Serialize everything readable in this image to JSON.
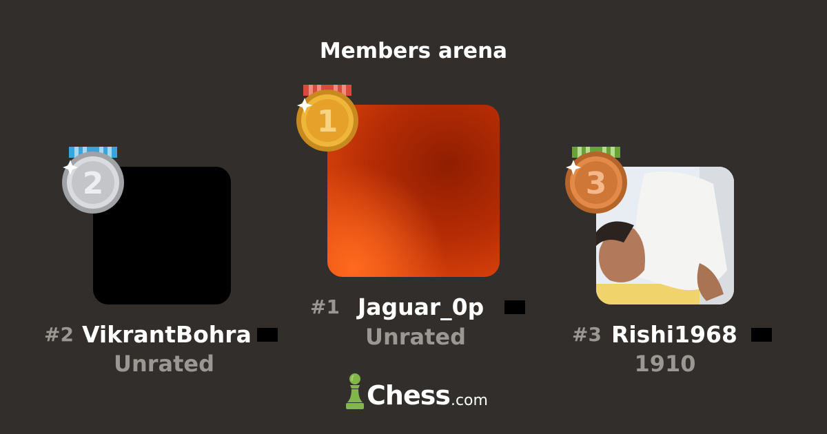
{
  "title": "Members arena",
  "players": [
    {
      "rank": "#1",
      "username": "Jaguar_0p",
      "rating": "Unrated",
      "medal": "gold-medal-1",
      "medal_digit": "1"
    },
    {
      "rank": "#2",
      "username": "VikrantBohra",
      "rating": "Unrated",
      "medal": "silver-medal-2",
      "medal_digit": "2"
    },
    {
      "rank": "#3",
      "username": "Rishi1968",
      "rating": "1910",
      "medal": "bronze-medal-3",
      "medal_digit": "3"
    }
  ],
  "logo": {
    "name": "Chess",
    "suffix": ".com",
    "icon": "pawn-icon"
  },
  "colors": {
    "background": "#312e2b",
    "muted": "#9b9894",
    "logo_green": "#81b64c"
  }
}
